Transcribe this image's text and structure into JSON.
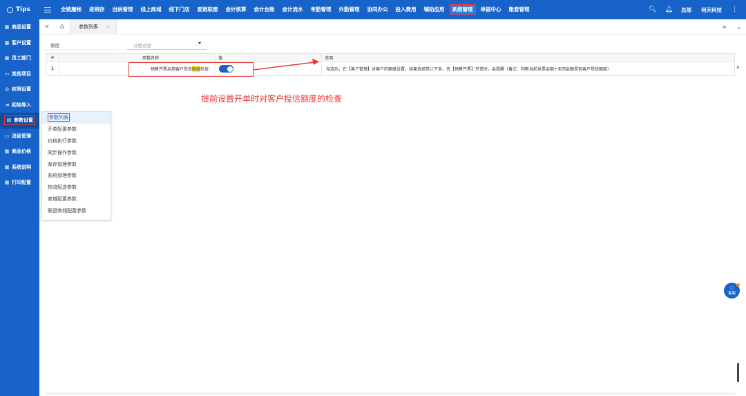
{
  "brand": {
    "title": "Tips"
  },
  "nav": {
    "items": [
      "全链履帐",
      "进销存",
      "出纳管理",
      "线上商城",
      "线下门店",
      "星链联盟",
      "会计核算",
      "会计台账",
      "会计流水",
      "考勤管理",
      "外勤管理",
      "协同办公",
      "投入费用",
      "辅助应用",
      "系统管理",
      "单据中心",
      "账套管理"
    ],
    "active": "系统管理"
  },
  "top_right": {
    "user": "总部",
    "company": "何天科技"
  },
  "sidebar": {
    "items": [
      {
        "label": "商品设置",
        "icon": "grid-icon"
      },
      {
        "label": "客户设置",
        "icon": "grid-icon"
      },
      {
        "label": "员工部门",
        "icon": "grid-icon"
      },
      {
        "label": "其他项目",
        "icon": "folder-icon"
      },
      {
        "label": "权限设置",
        "icon": "shield-icon"
      },
      {
        "label": "初始导入",
        "icon": "import-icon"
      },
      {
        "label": "参数设置",
        "icon": "settings-icon"
      },
      {
        "label": "消息管理",
        "icon": "message-icon"
      },
      {
        "label": "商品价格",
        "icon": "grid-icon"
      },
      {
        "label": "系统说明",
        "icon": "grid-icon"
      },
      {
        "label": "打印配置",
        "icon": "grid-icon"
      }
    ],
    "active": "参数设置"
  },
  "tabs": {
    "current": "参数列表"
  },
  "filter": {
    "value": "额度",
    "select_placeholder": "分组过滤"
  },
  "table": {
    "headers": {
      "num": "#",
      "name": "参数名称",
      "value": "值",
      "desc": "说明"
    },
    "rows": [
      {
        "num": "1",
        "name_pre": "销售开票启用客户授信",
        "name_hl": "额度",
        "name_post": "检查：",
        "enabled": true,
        "desc": "勾选后，在【客户管理】对客户的额度设置，如果选择禁止下单，去【销售开票】开单时，会提醒（备注：判断当前发票金额+未回金额是否客户授信额度）"
      }
    ]
  },
  "annotation": {
    "text": "提前设置开单时对客户授信额度的检查",
    "color": "#e53935"
  },
  "dropdown": {
    "items": [
      "参数列表",
      "开单配置参数",
      "价格执行参数",
      "同步操作参数",
      "库存管理参数",
      "系统管理参数",
      "物流配送参数",
      "商城配置参数",
      "联盟商城配置参数"
    ],
    "active": "参数列表"
  },
  "kefu": {
    "label": "客服"
  },
  "colors": {
    "primary": "#1763c9",
    "accent": "#e53935"
  }
}
